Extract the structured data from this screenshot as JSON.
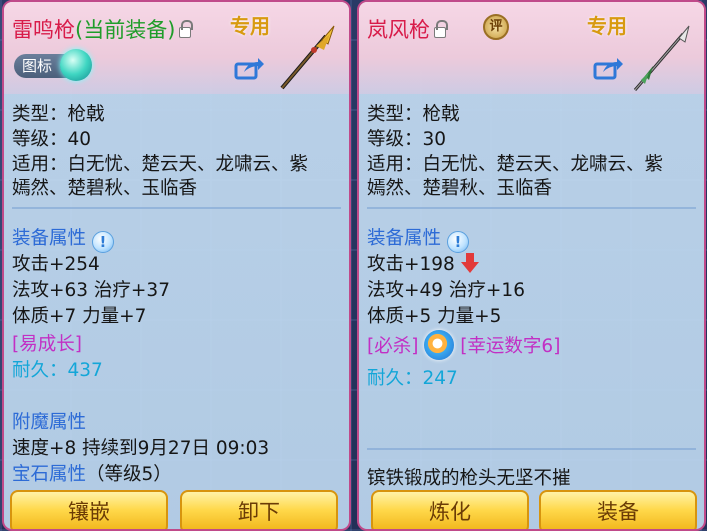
{
  "left": {
    "name": "雷鸣枪",
    "status": "(当前装备)",
    "special": "专用",
    "icon_badge": "图标",
    "type_line": "类型：枪戟",
    "level_line": "等级：40",
    "use_line1": "适用：白无忧、楚云天、龙啸云、紫",
    "use_line2": "嫣然、楚碧秋、玉临香",
    "attr_title": "装备属性",
    "attack": "攻击+254",
    "magic": "法攻+63 治疗+37",
    "physique": "体质+7 力量+7",
    "trait": "[易成长]",
    "durability_label": "耐久：",
    "durability_value": "437",
    "enchant_title": "附魔属性",
    "enchant_line": "速度+8 持续到9月27日 09:03",
    "gem_title": "宝石属性",
    "gem_level": "（等级5）",
    "buttons": [
      "镶嵌",
      "卸下"
    ]
  },
  "right": {
    "name": "岚风枪",
    "seal": "评",
    "special": "专用",
    "type_line": "类型：枪戟",
    "level_line": "等级：30",
    "use_line1": "适用：白无忧、楚云天、龙啸云、紫",
    "use_line2": "嫣然、楚碧秋、玉临香",
    "attr_title": "装备属性",
    "attack": "攻击+198",
    "magic": "法攻+49 治疗+16",
    "physique": "体质+5 力量+5",
    "trait1": "[必杀]",
    "trait2": "[幸运数字6]",
    "durability_label": "耐久：",
    "durability_value": "247",
    "description": "镔铁锻成的枪头无坚不摧",
    "buttons": [
      "炼化",
      "装备"
    ]
  },
  "colors": {
    "name": "#d81c4a",
    "current": "#1f9d2a",
    "special": "#d89a10",
    "section_title": "#2d6bd6",
    "trait": "#c22fc4",
    "durability": "#13a6d8",
    "button": "#ffd84a"
  },
  "icons": [
    "lock-icon",
    "share-icon",
    "info-icon",
    "down-arrow-icon",
    "swirl-icon",
    "spear-icon",
    "seal-icon"
  ]
}
